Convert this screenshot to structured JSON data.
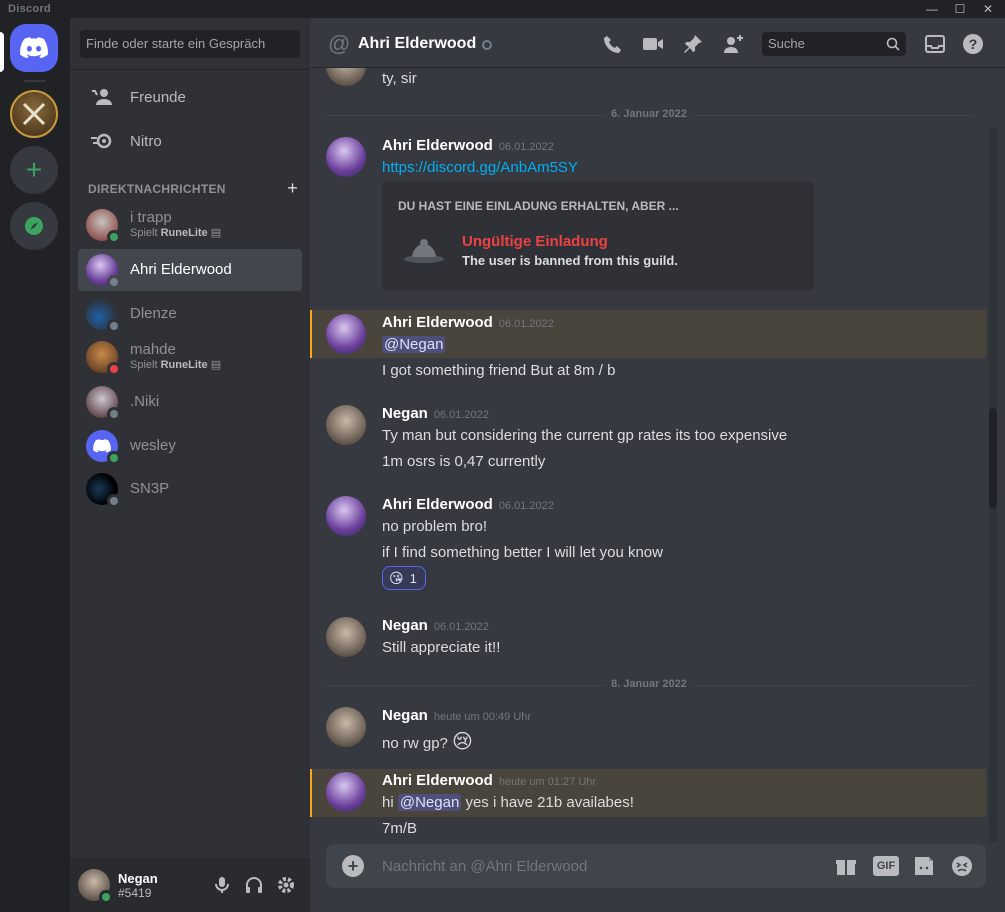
{
  "window": {
    "brand": "Discord",
    "minimize": "—",
    "maximize": "☐",
    "close": "✕"
  },
  "sidebar": {
    "search_placeholder": "Finde oder starte ein Gespräch",
    "nav": [
      {
        "label": "Freunde",
        "icon": "friends-icon"
      },
      {
        "label": "Nitro",
        "icon": "nitro-icon"
      }
    ],
    "dm_header": "DIREKTNACHRICHTEN",
    "dm_add": "+",
    "dms": [
      {
        "name": "i trapp",
        "status": "online",
        "activity_prefix": "Spielt",
        "activity": "RuneLite"
      },
      {
        "name": "Ahri Elderwood",
        "status": "offline",
        "active": true
      },
      {
        "name": "Dlenze",
        "status": "offline"
      },
      {
        "name": "mahde",
        "status": "dnd",
        "activity_prefix": "Spielt",
        "activity": "RuneLite"
      },
      {
        "name": ".Niki",
        "status": "offline"
      },
      {
        "name": "wesley",
        "status": "online"
      },
      {
        "name": "SN3P",
        "status": "offline"
      }
    ],
    "user": {
      "name": "Negan",
      "tag": "#5419",
      "status": "online"
    }
  },
  "header": {
    "title": "Ahri Elderwood",
    "search_placeholder": "Suche"
  },
  "messages": {
    "top_fragment": "ty, sir",
    "divider1": "6. Januar 2022",
    "m1": {
      "author": "Ahri Elderwood",
      "time": "06.01.2022",
      "link": "https://discord.gg/AnbAm5SY"
    },
    "embed": {
      "heading": "DU HAST EINE EINLADUNG ERHALTEN, ABER ...",
      "title": "Ungültige Einladung",
      "subtitle": "The user is banned from this guild."
    },
    "m2": {
      "author": "Ahri Elderwood",
      "time": "06.01.2022",
      "mention": "@Negan",
      "line2": "I got something friend But at 8m / b"
    },
    "m3": {
      "author": "Negan",
      "time": "06.01.2022",
      "line1": "Ty man but considering the current gp rates its too expensive",
      "line2": "1m osrs is 0,47 currently"
    },
    "m4": {
      "author": "Ahri Elderwood",
      "time": "06.01.2022",
      "line1": "no problem bro!",
      "line2": "if I find something better I will let you know",
      "reaction_emoji": "😘",
      "reaction_count": "1"
    },
    "m5": {
      "author": "Negan",
      "time": "06.01.2022",
      "line1": "Still appreciate it!!"
    },
    "divider2": "8. Januar 2022",
    "m6": {
      "author": "Negan",
      "time": "heute um 00:49 Uhr",
      "line1": "no rw gp?",
      "emoji": "😢"
    },
    "m7": {
      "author": "Ahri Elderwood",
      "time": "heute um 01:27 Uhr",
      "prefix": "hi",
      "mention": "@Negan",
      "suffix": "yes i have 21b availabes!",
      "line2": "7m/B"
    }
  },
  "composer": {
    "placeholder": "Nachricht an @Ahri Elderwood",
    "gif": "GIF"
  },
  "colors": {
    "accent": "#5865f2",
    "online": "#3ba55d",
    "dnd": "#ed4245",
    "mention_highlight": "#faa81a"
  }
}
